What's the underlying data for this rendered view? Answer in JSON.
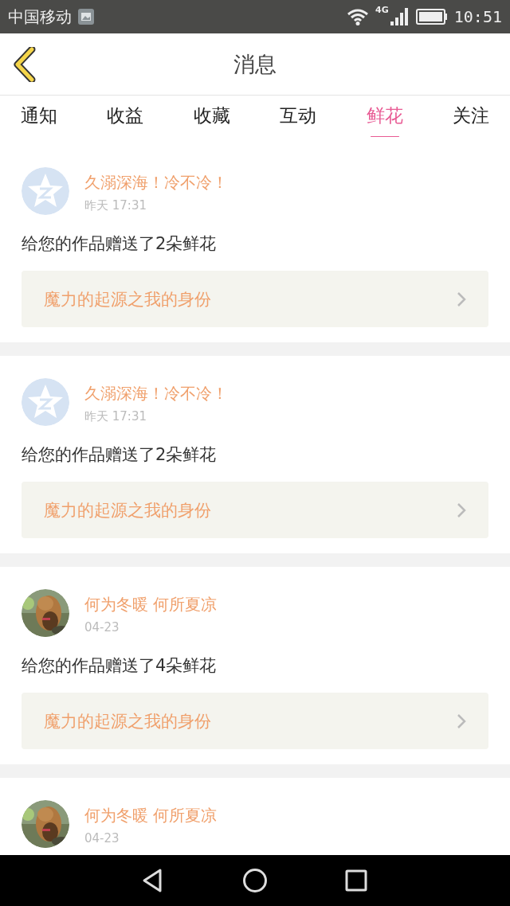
{
  "status_bar": {
    "carrier": "中国移动",
    "network": "4G",
    "time": "10:51"
  },
  "header": {
    "title": "消息"
  },
  "tabs": [
    {
      "label": "通知",
      "selected": false
    },
    {
      "label": "收益",
      "selected": false
    },
    {
      "label": "收藏",
      "selected": false
    },
    {
      "label": "互动",
      "selected": false
    },
    {
      "label": "鲜花",
      "selected": true
    },
    {
      "label": "关注",
      "selected": false
    }
  ],
  "messages": [
    {
      "avatar": {
        "kind": "icon"
      },
      "name": "久溺深海！冷不冷！",
      "time": "昨天 17:31",
      "text": "给您的作品赠送了2朵鲜花",
      "work": "魔力的起源之我的身份"
    },
    {
      "avatar": {
        "kind": "icon"
      },
      "name": "久溺深海！冷不冷！",
      "time": "昨天 17:31",
      "text": "给您的作品赠送了2朵鲜花",
      "work": "魔力的起源之我的身份"
    },
    {
      "name": "何为冬暖 何所夏凉",
      "time": "04-23",
      "text": "给您的作品赠送了4朵鲜花",
      "work": "魔力的起源之我的身份"
    },
    {
      "name": "何为冬暖 何所夏凉",
      "time": "04-23"
    }
  ]
}
